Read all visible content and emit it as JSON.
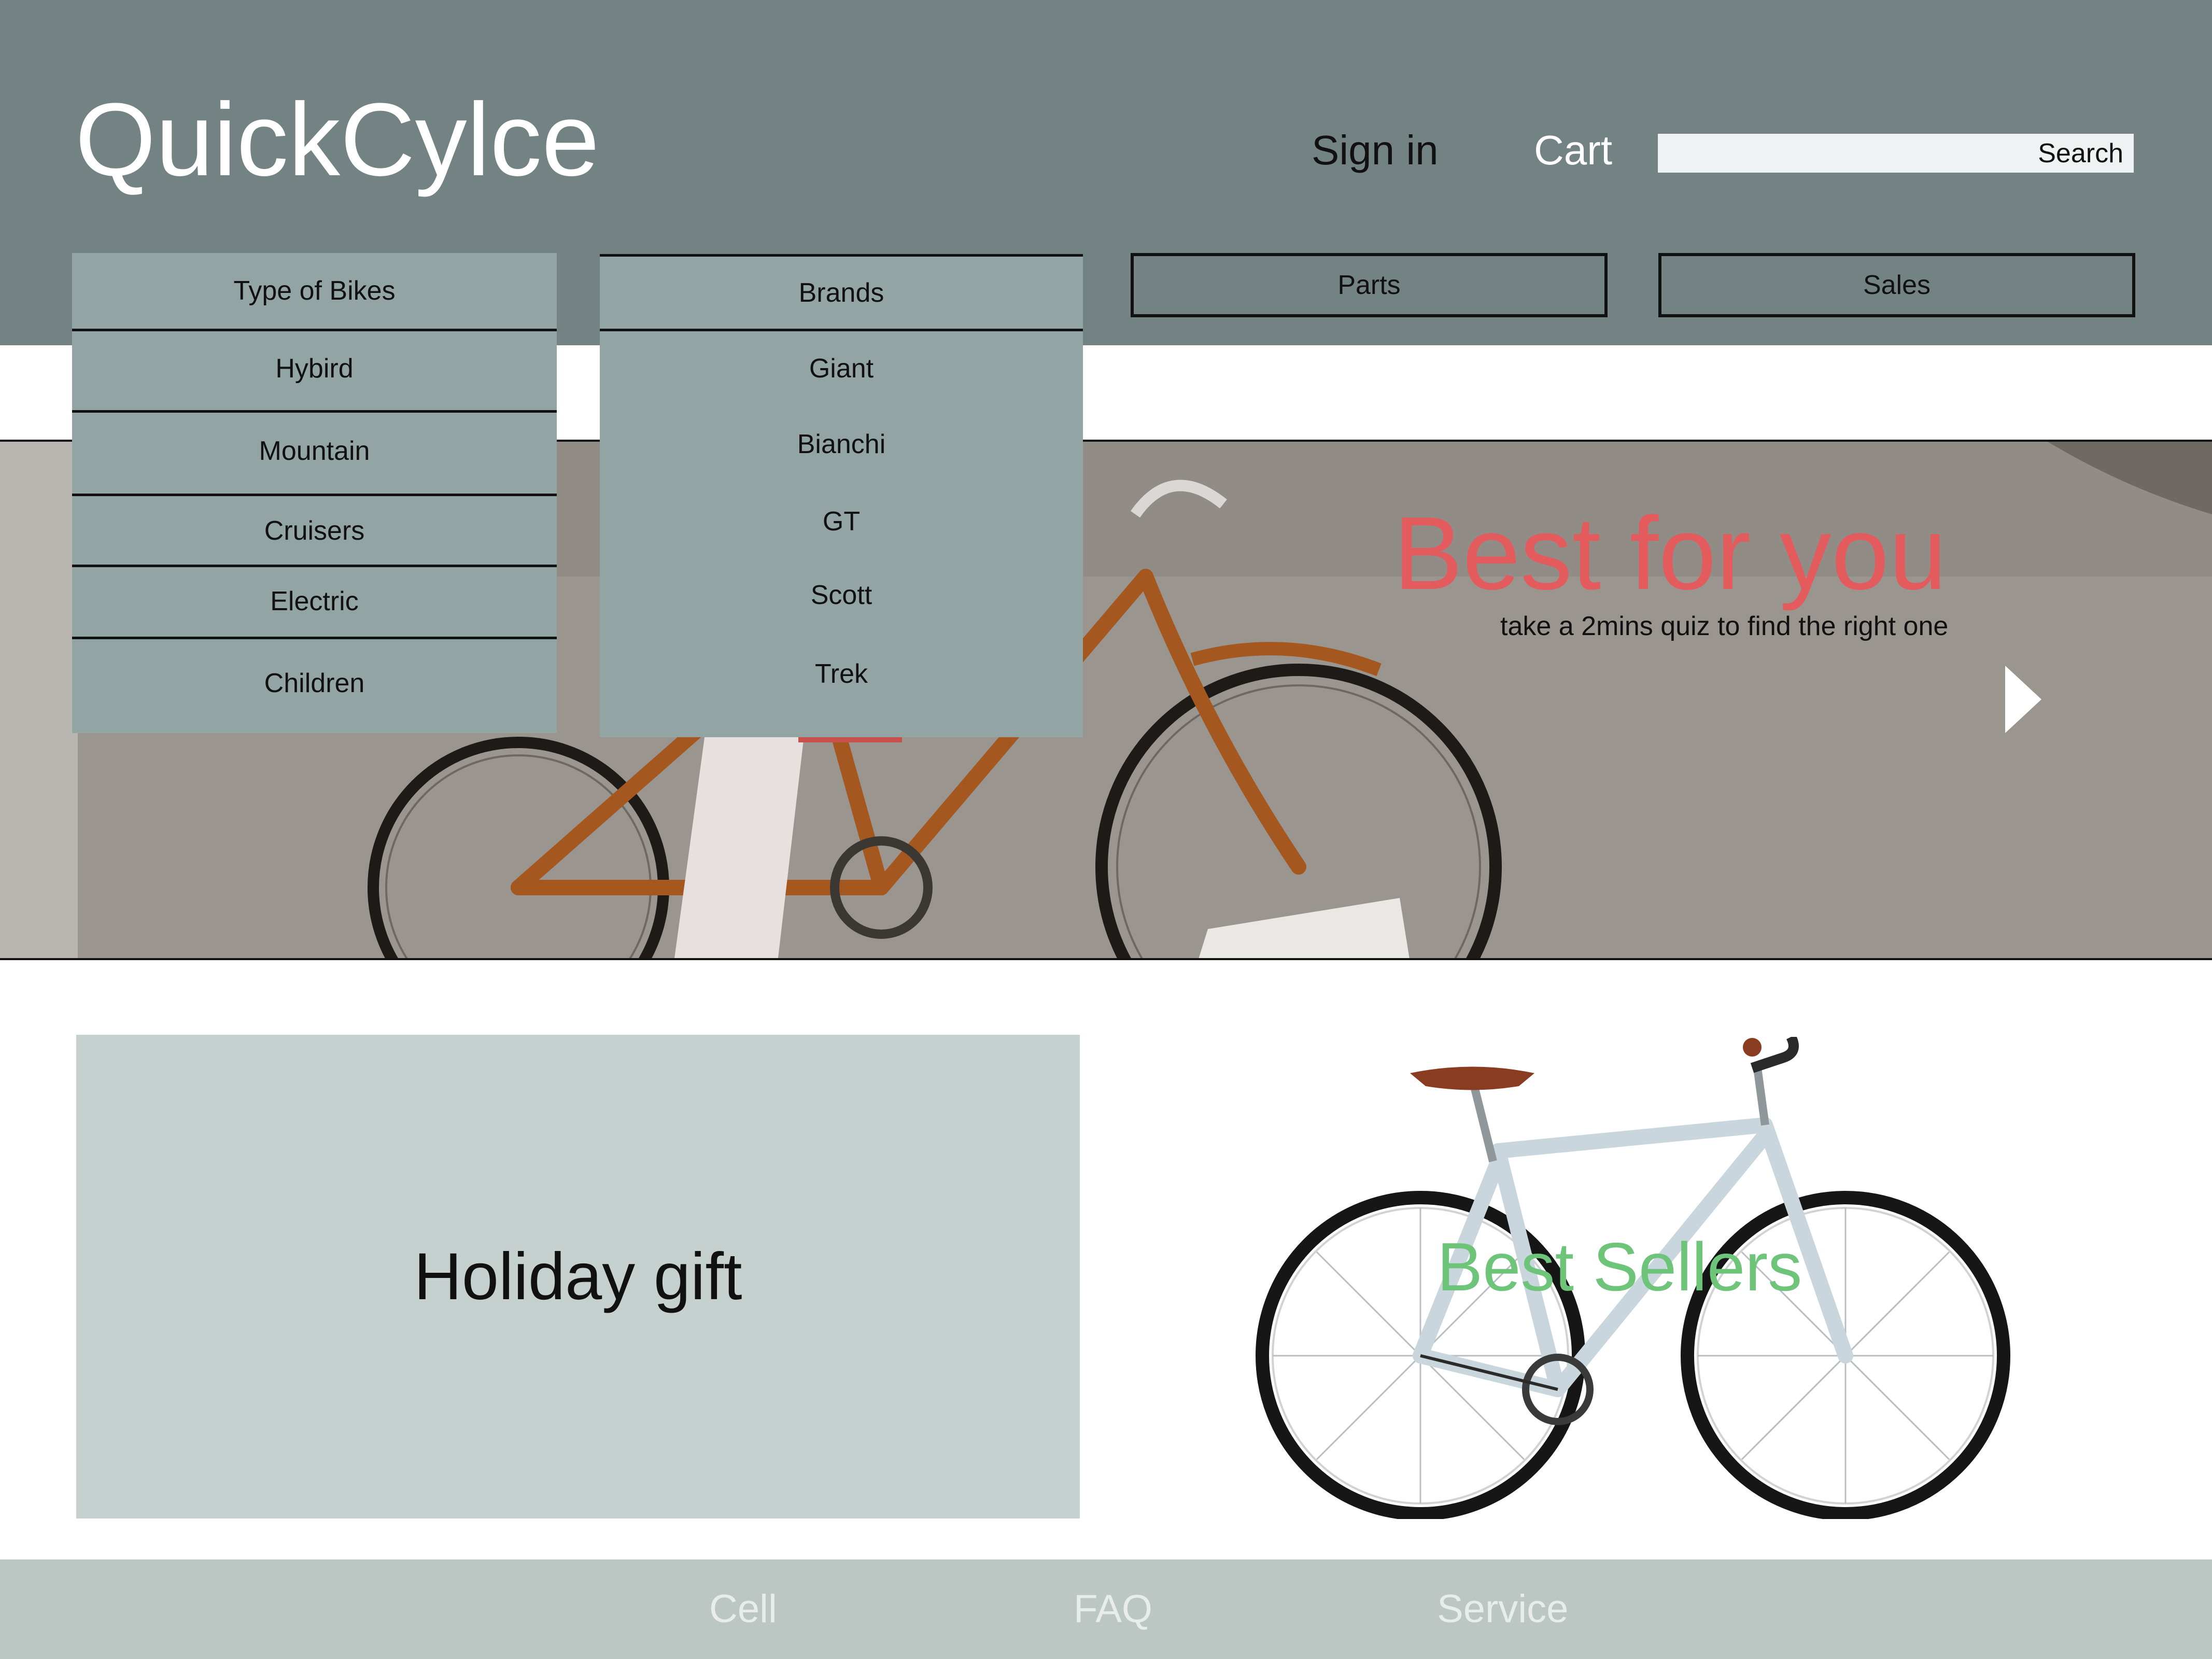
{
  "header": {
    "logo": "QuickCylce",
    "sign_in": "Sign in",
    "cart": "Cart",
    "search_label": "Search"
  },
  "nav": {
    "types": {
      "label": "Type of Bikes",
      "items": [
        "Hybird",
        "Mountain",
        "Cruisers",
        "Electric",
        "Children"
      ]
    },
    "brands": {
      "label": "Brands",
      "items": [
        "Giant",
        "Bianchi",
        "GT",
        "Scott",
        "Trek"
      ]
    },
    "parts": "Parts",
    "sales": "Sales"
  },
  "hero": {
    "title": "Best for you",
    "subtitle": "take a 2mins quiz to find the right one"
  },
  "promo": {
    "holiday": "Holiday gift",
    "best_sellers": "Best Sellers"
  },
  "footer": {
    "links": [
      "Cell",
      "FAQ",
      "Service"
    ]
  },
  "colors": {
    "header_bg": "#738384",
    "dropdown_bg": "#92a4a4",
    "hero_title": "#e45b5e",
    "best_sellers": "#6ec57a",
    "holiday_card": "#c6d0cf",
    "footer_bg": "#bcc6c3"
  }
}
